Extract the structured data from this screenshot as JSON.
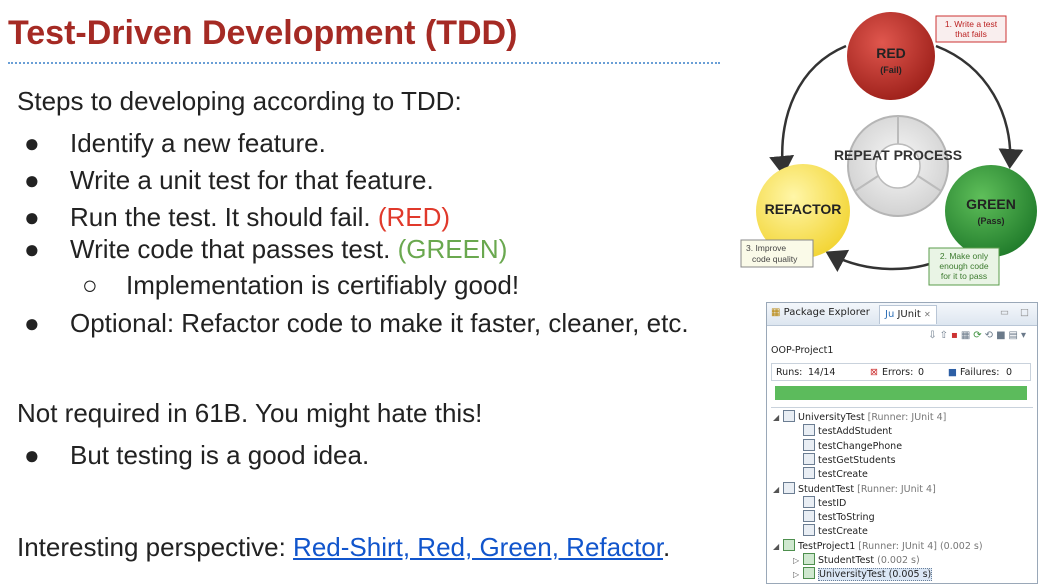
{
  "title": "Test-Driven Development (TDD)",
  "intro": "Steps to developing according to TDD:",
  "steps": [
    {
      "text": "Identify a new feature.",
      "tag": ""
    },
    {
      "text": "Write a unit test for that feature.",
      "tag": ""
    },
    {
      "text": "Run the test. It should fail. ",
      "tag": "(RED)"
    },
    {
      "text": "Write code that passes test. ",
      "tag": "(GREEN)"
    }
  ],
  "substep": "Implementation is certifiably good!",
  "optional": "Optional: Refactor code to make it faster, cleaner, etc.",
  "note": "Not required in 61B. You might hate this!",
  "note_bullet": "But testing is a good idea.",
  "perspective_prefix": "Interesting perspective: ",
  "perspective_link": "Red-Shirt, Red, Green, Refactor",
  "perspective_suffix": ".",
  "colors": {
    "title": "#a52a24",
    "red": "#e0392b",
    "green": "#6aa84f",
    "link": "#1155cc"
  },
  "diagram": {
    "red_label": "RED",
    "red_sub": "(Fail)",
    "green_label": "GREEN",
    "green_sub": "(Pass)",
    "refactor_label": "REFACTOR",
    "center_label": "REPEAT PROCESS",
    "callout1_l1": "1. Write a test",
    "callout1_l2": "that fails",
    "callout2_l1": "2. Make only",
    "callout2_l2": "enough code",
    "callout2_l3": "for it to pass",
    "callout3_l1": "3. Improve",
    "callout3_l2": "code quality"
  },
  "junit": {
    "tab1": "Package Explorer",
    "tab2": "JUnit",
    "tab2_close": "✕",
    "project": "OOP-Project1",
    "runs_label": "Runs:",
    "runs": "14/14",
    "errors_label": "Errors:",
    "errors": "0",
    "failures_label": "Failures:",
    "failures": "0",
    "progress": 1.0,
    "tree": [
      {
        "name": "UniversityTest",
        "meta": "[Runner: JUnit 4]",
        "level": 0
      },
      {
        "name": "testAddStudent",
        "meta": "",
        "level": 1
      },
      {
        "name": "testChangePhone",
        "meta": "",
        "level": 1
      },
      {
        "name": "testGetStudents",
        "meta": "",
        "level": 1
      },
      {
        "name": "testCreate",
        "meta": "",
        "level": 1
      },
      {
        "name": "StudentTest",
        "meta": "[Runner: JUnit 4]",
        "level": 0
      },
      {
        "name": "testID",
        "meta": "",
        "level": 1
      },
      {
        "name": "testToString",
        "meta": "",
        "level": 1
      },
      {
        "name": "testCreate",
        "meta": "",
        "level": 1
      },
      {
        "name": "TestProject1",
        "meta": "[Runner: JUnit 4] (0.002 s)",
        "level": 0
      },
      {
        "name": "StudentTest",
        "meta": "(0.002 s)",
        "level": 1
      },
      {
        "name": "UniversityTest (0.005 s)",
        "meta": "",
        "level": 1
      }
    ]
  }
}
